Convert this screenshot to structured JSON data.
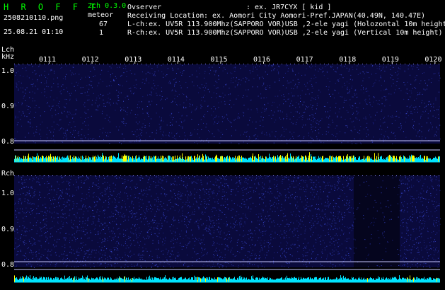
{
  "header": {
    "app_title": "H R O F F T",
    "version": "2ch 0.3.0",
    "filename": "2508210110.png",
    "datetime": "25.08.21 01:10",
    "meteor_label": "meteor",
    "meteor_lch_count": "67",
    "meteor_rch_count": "1",
    "observer_label": "Ovserver",
    "observer_value": ": ex. JR7CYX [ kid ]",
    "location_label": "Receiving Location",
    "location_value": ": ex. Aomori City Aomori-Pref.JAPAN(40.49N, 140.47E)",
    "lch_info": "L-ch:ex. UV5R 113.900Mhz(SAPPORO VOR)USB ,2-ele yagi (Holozontal 10m height",
    "rch_info": "R-ch:ex. UV5R 113.900Mhz(SAPPORO VOR)USB ,2-ele yagi (Vertical 10m height)"
  },
  "lch": {
    "channel_label": "Lch",
    "unit_label": "kHz",
    "yticks": [
      "1.0",
      "0.9",
      "0.8"
    ]
  },
  "rch": {
    "channel_label": "Rch",
    "yticks": [
      "1.0",
      "0.9",
      "0.8"
    ]
  },
  "minute_labels": [
    "0111",
    "0112",
    "0113",
    "0114",
    "0115",
    "0116",
    "0117",
    "0118",
    "0119",
    "0120"
  ],
  "colors": {
    "background": "#000000",
    "text_green": "#00ff00",
    "text_white": "#ffffff",
    "waterfall_base": "#0a0a3c",
    "signal_line": "#c8c8ff",
    "level_cyan": "#00e5ff",
    "level_yellow": "#ffff00"
  }
}
